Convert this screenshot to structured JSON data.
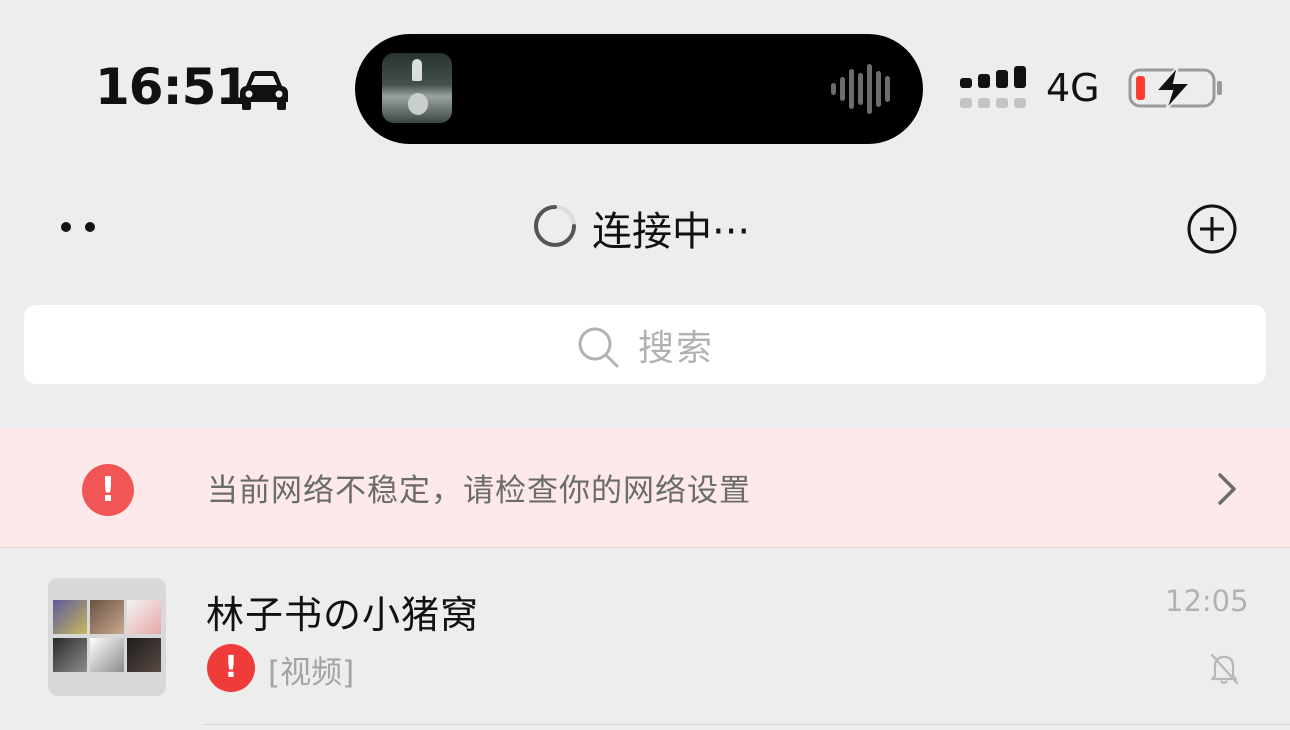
{
  "status_bar": {
    "time": "16:51",
    "network": "4G",
    "icons": [
      "car-icon",
      "signal-icon",
      "battery-charging-icon"
    ],
    "battery_color": "#ff3b30"
  },
  "nav": {
    "title": "连接中···",
    "icons": [
      "more-icon",
      "loading-spinner-icon",
      "add-icon"
    ]
  },
  "search": {
    "placeholder": "搜索"
  },
  "alert": {
    "message": "当前网络不稳定，请检查你的网络设置",
    "icon_symbol": "!",
    "color": "#f25555"
  },
  "chats": [
    {
      "name": "林子书の小猪窝",
      "time": "12:05",
      "preview": "[视频]",
      "status_symbol": "!",
      "muted": true
    }
  ]
}
